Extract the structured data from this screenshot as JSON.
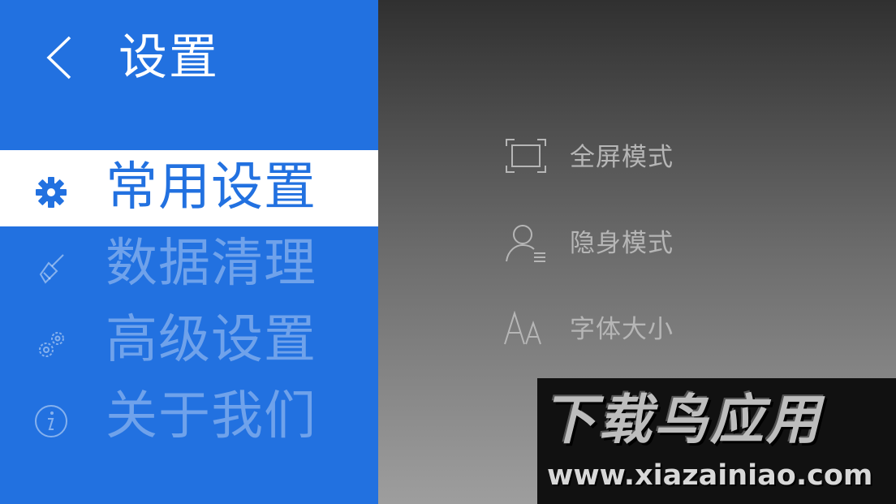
{
  "header": {
    "title": "设置",
    "back_icon": "chevron-left-icon"
  },
  "sidebar": {
    "items": [
      {
        "label": "常用设置",
        "icon": "gear-icon",
        "active": true
      },
      {
        "label": "数据清理",
        "icon": "broom-icon",
        "active": false
      },
      {
        "label": "高级设置",
        "icon": "gears-icon",
        "active": false
      },
      {
        "label": "关于我们",
        "icon": "info-icon",
        "active": false
      }
    ]
  },
  "options": [
    {
      "label": "全屏模式",
      "icon": "fullscreen-icon"
    },
    {
      "label": "隐身模式",
      "icon": "incognito-user-icon"
    },
    {
      "label": "字体大小",
      "icon": "font-size-icon"
    }
  ],
  "watermark": {
    "title": "下载鸟应用",
    "url": "www.xiazainiao.com"
  },
  "colors": {
    "accent": "#2271e0",
    "active_bg": "#ffffff",
    "inactive_text": "rgba(255,255,255,0.35)"
  }
}
